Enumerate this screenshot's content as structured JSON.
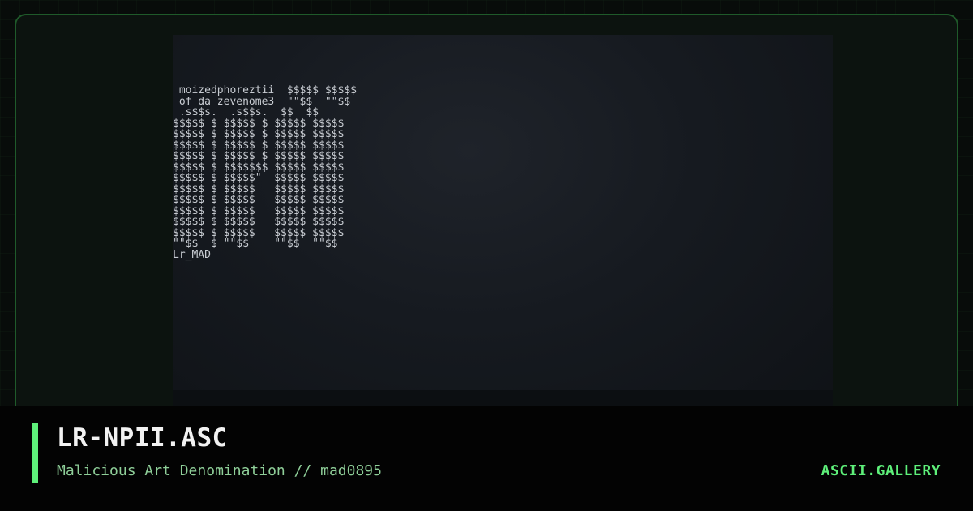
{
  "artwork": {
    "ascii_lines": [
      " moizedphoreztii  $$$$$ $$$$$",
      " of da zevenome3  \"\"$$  \"\"$$",
      " .s$$s.  .s$$s.  $$  $$",
      "$$$$$ $ $$$$$ $ $$$$$ $$$$$",
      "$$$$$ $ $$$$$ $ $$$$$ $$$$$",
      "$$$$$ $ $$$$$ $ $$$$$ $$$$$",
      "$$$$$ $ $$$$$ $ $$$$$ $$$$$",
      "$$$$$ $ $$$$$$$ $$$$$ $$$$$",
      "$$$$$ $ $$$$$\"  $$$$$ $$$$$",
      "$$$$$ $ $$$$$   $$$$$ $$$$$",
      "$$$$$ $ $$$$$   $$$$$ $$$$$",
      "$$$$$ $ $$$$$   $$$$$ $$$$$",
      "$$$$$ $ $$$$$   $$$$$ $$$$$",
      "$$$$$ $ $$$$$   $$$$$ $$$$$",
      "\"\"$$  $ \"\"$$    \"\"$$  \"\"$$",
      "Lr_MAD"
    ]
  },
  "caption": {
    "title": "LR-NPII.ASC",
    "subtitle": "Malicious Art Denomination // mad0895",
    "brand": "ASCII.GALLERY"
  },
  "colors": {
    "accent": "#5ef07a",
    "frame_border": "#1f5a2a",
    "subtitle": "#8fcf99"
  }
}
